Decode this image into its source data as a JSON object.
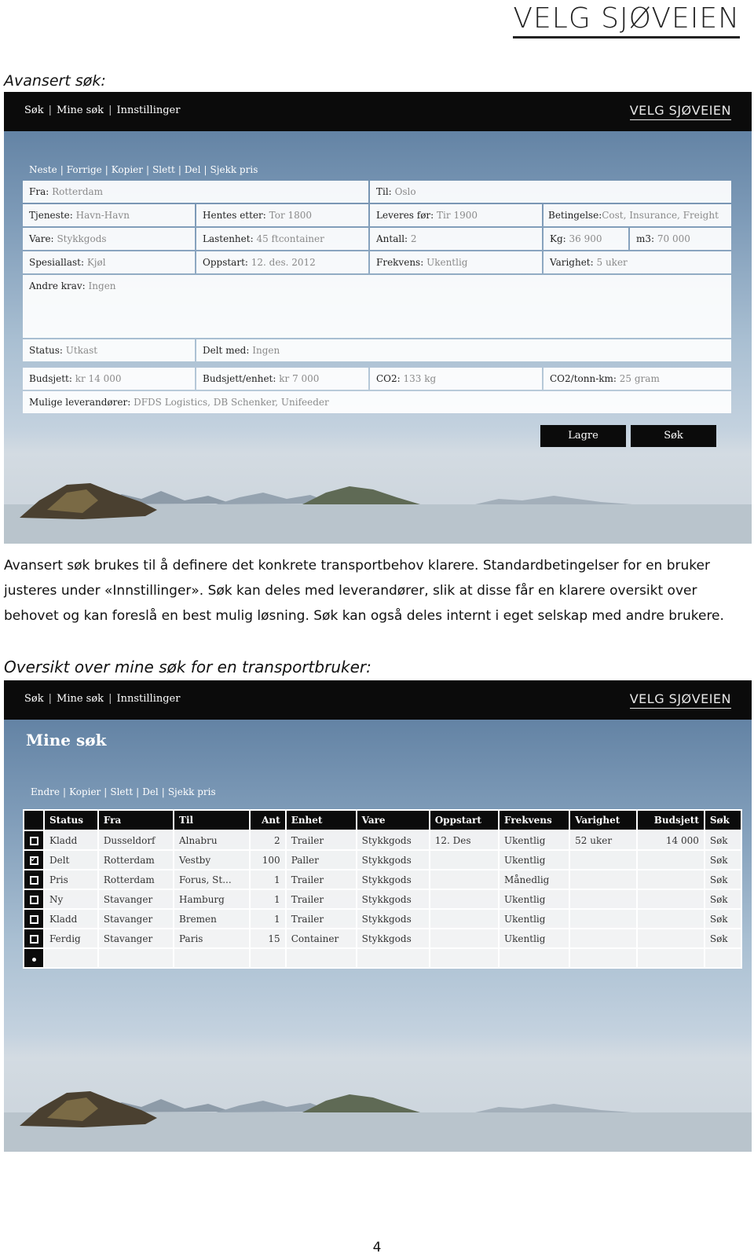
{
  "header": {
    "brand": "VELG SJØVEIEN"
  },
  "section1": {
    "heading": "Avansert søk:",
    "nav": {
      "sok": "Søk",
      "mine_sok": "Mine søk",
      "innstillinger": "Innstillinger"
    },
    "brand": "VELG SJØVEIEN",
    "actions": {
      "neste": "Neste",
      "forrige": "Forrige",
      "kopier": "Kopier",
      "slett": "Slett",
      "del": "Del",
      "sjekk_pris": "Sjekk pris"
    },
    "fields": {
      "fra": {
        "label": "Fra:",
        "value": "Rotterdam"
      },
      "til": {
        "label": "Til:",
        "value": "Oslo"
      },
      "tjeneste": {
        "label": "Tjeneste:",
        "value": "Havn-Havn"
      },
      "hentes": {
        "label": "Hentes etter:",
        "value": "Tor 1800"
      },
      "leveres": {
        "label": "Leveres før:",
        "value": "Tir 1900"
      },
      "betingelse": {
        "label": "Betingelse:",
        "value": "Cost, Insurance, Freight"
      },
      "vare": {
        "label": "Vare:",
        "value": "Stykkgods"
      },
      "lastenhet": {
        "label": "Lastenhet:",
        "value": "45 ftcontainer"
      },
      "antall": {
        "label": "Antall:",
        "value": "2"
      },
      "kg": {
        "label": "Kg:",
        "value": "36 900"
      },
      "m3": {
        "label": "m3:",
        "value": "70 000"
      },
      "spesiallast": {
        "label": "Spesiallast:",
        "value": "Kjøl"
      },
      "oppstart": {
        "label": "Oppstart:",
        "value": "12. des. 2012"
      },
      "frekvens": {
        "label": "Frekvens:",
        "value": "Ukentlig"
      },
      "varighet": {
        "label": "Varighet:",
        "value": "5 uker"
      },
      "andre_krav": {
        "label": "Andre krav:",
        "value": "Ingen"
      },
      "status": {
        "label": "Status:",
        "value": "Utkast"
      },
      "delt_med": {
        "label": "Delt med:",
        "value": "Ingen"
      },
      "budsjett": {
        "label": "Budsjett:",
        "value": "kr 14 000"
      },
      "budsjett_enhet": {
        "label": "Budsjett/enhet:",
        "value": "kr 7 000"
      },
      "co2": {
        "label": "CO2:",
        "value": "133  kg"
      },
      "co2_tonn": {
        "label": "CO2/tonn-km:",
        "value": "25  gram"
      },
      "leverandorer": {
        "label": "Mulige leverandører:",
        "value": "DFDS Logistics, DB Schenker, Unifeeder"
      }
    },
    "buttons": {
      "lagre": "Lagre",
      "sok": "Søk"
    }
  },
  "paragraph": "Avansert søk brukes til å definere det konkrete transportbehov klarere. Standardbetingelser for en bruker justeres under «Innstillinger». Søk kan deles med leverandører, slik at disse får en klarere oversikt over behovet og kan foreslå en best mulig løsning. Søk kan også deles internt i eget selskap med andre brukere.",
  "section2": {
    "heading": "Oversikt over mine søk for en transportbruker:",
    "nav": {
      "sok": "Søk",
      "mine_sok": "Mine søk",
      "innstillinger": "Innstillinger"
    },
    "brand": "VELG SJØVEIEN",
    "title": "Mine søk",
    "actions": {
      "endre": "Endre",
      "kopier": "Kopier",
      "slett": "Slett",
      "del": "Del",
      "sjekk_pris": "Sjekk pris"
    },
    "columns": [
      "Status",
      "Fra",
      "Til",
      "Ant",
      "Enhet",
      "Vare",
      "Oppstart",
      "Frekvens",
      "Varighet",
      "Budsjett",
      "Søk"
    ],
    "rows": [
      {
        "checked": false,
        "cells": [
          "Kladd",
          "Dusseldorf",
          "Alnabru",
          "2",
          "Trailer",
          "Stykkgods",
          "12. Des",
          "Ukentlig",
          "52 uker",
          "14 000",
          "Søk"
        ]
      },
      {
        "checked": true,
        "cells": [
          "Delt",
          "Rotterdam",
          "Vestby",
          "100",
          "Paller",
          "Stykkgods",
          "",
          "Ukentlig",
          "",
          "",
          "Søk"
        ]
      },
      {
        "checked": false,
        "cells": [
          "Pris",
          "Rotterdam",
          "Forus, St...",
          "1",
          "Trailer",
          "Stykkgods",
          "",
          "Månedlig",
          "",
          "",
          "Søk"
        ]
      },
      {
        "checked": false,
        "cells": [
          "Ny",
          "Stavanger",
          "Hamburg",
          "1",
          "Trailer",
          "Stykkgods",
          "",
          "Ukentlig",
          "",
          "",
          "Søk"
        ]
      },
      {
        "checked": false,
        "cells": [
          "Kladd",
          "Stavanger",
          "Bremen",
          "1",
          "Trailer",
          "Stykkgods",
          "",
          "Ukentlig",
          "",
          "",
          "Søk"
        ]
      },
      {
        "checked": false,
        "cells": [
          "Ferdig",
          "Stavanger",
          "Paris",
          "15",
          "Container",
          "Stykkgods",
          "",
          "Ukentlig",
          "",
          "",
          "Søk"
        ]
      }
    ]
  },
  "page_number": "4"
}
